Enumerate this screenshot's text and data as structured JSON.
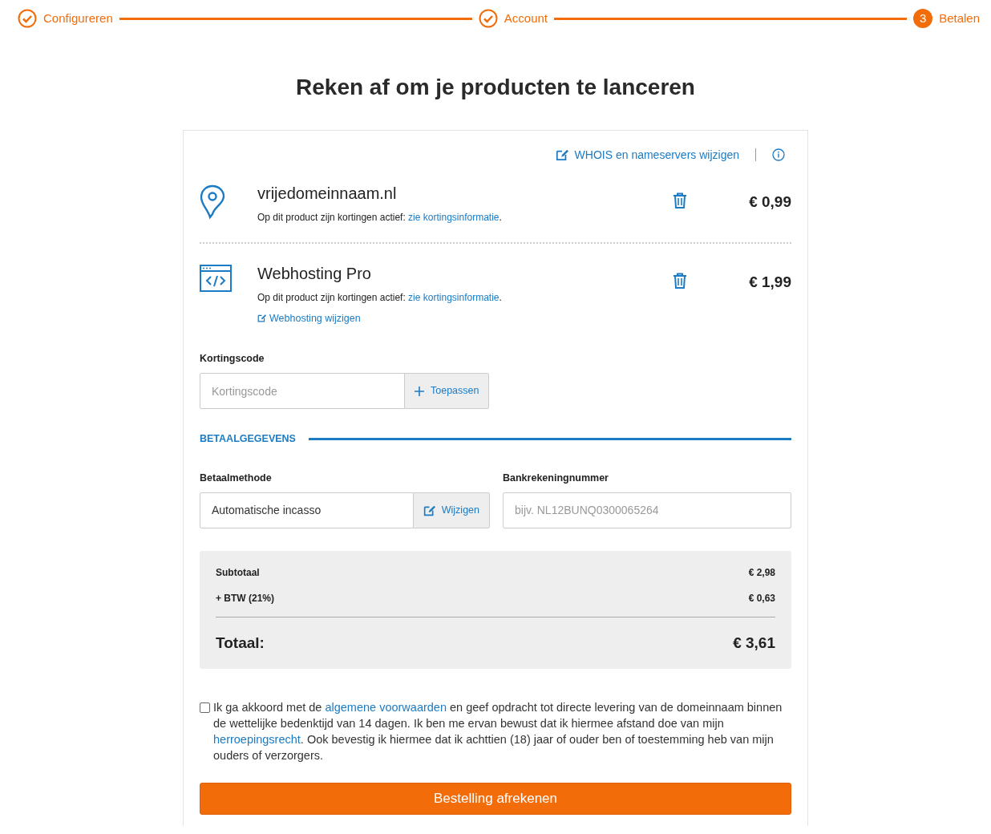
{
  "steps": [
    {
      "label": "Configureren",
      "done": true
    },
    {
      "label": "Account",
      "done": true
    },
    {
      "label": "Betalen",
      "done": false,
      "number": "3"
    }
  ],
  "title": "Reken af om je producten te lanceren",
  "whois_link": "WHOIS en nameservers wijzigen",
  "products": [
    {
      "kind": "domain",
      "name": "vrijedomeinnaam.nl",
      "note": [
        {
          "kind": "text",
          "text": "Op dit product zijn kortingen actief: "
        },
        {
          "kind": "link",
          "text": "zie kortingsinformatie"
        },
        {
          "kind": "text",
          "text": "."
        }
      ],
      "price": "€ 0,99"
    },
    {
      "kind": "hosting",
      "name": "Webhosting Pro",
      "note": [
        {
          "kind": "text",
          "text": "Op dit product zijn kortingen actief: "
        },
        {
          "kind": "link",
          "text": "zie kortingsinformatie"
        },
        {
          "kind": "text",
          "text": "."
        }
      ],
      "edit_link": "Webhosting wijzigen",
      "price": "€ 1,99"
    }
  ],
  "discount": {
    "label": "Kortingscode",
    "placeholder": "Kortingscode",
    "button": "Toepassen"
  },
  "payment_heading": "BETAALGEGEVENS",
  "payment_method": {
    "label": "Betaalmethode",
    "value": "Automatische incasso",
    "button": "Wijzigen"
  },
  "bank_account": {
    "label": "Bankrekeningnummer",
    "placeholder": "bijv. NL12BUNQ0300065264"
  },
  "summary": {
    "rows": [
      {
        "label": "Subtotaal",
        "value": "€ 2,98"
      },
      {
        "label": "+ BTW (21%)",
        "value": "€ 0,63"
      }
    ],
    "total_label": "Totaal:",
    "total_value": "€ 3,61"
  },
  "consent": {
    "checked": false,
    "parts": [
      {
        "kind": "text",
        "text": "Ik ga akkoord met de "
      },
      {
        "kind": "link",
        "text": "algemene voorwaarden"
      },
      {
        "kind": "text",
        "text": " en geef opdracht tot directe levering van de domeinnaam binnen de wettelijke bedenktijd van 14 dagen. Ik ben me ervan bewust dat ik hiermee afstand doe van mijn "
      },
      {
        "kind": "link",
        "text": "herroepingsrecht"
      },
      {
        "kind": "text",
        "text": ". Ook bevestig ik hiermee dat ik achttien (18) jaar of ouder ben of toestemming heb van mijn ouders of verzorgers."
      }
    ]
  },
  "submit": "Bestelling afrekenen"
}
